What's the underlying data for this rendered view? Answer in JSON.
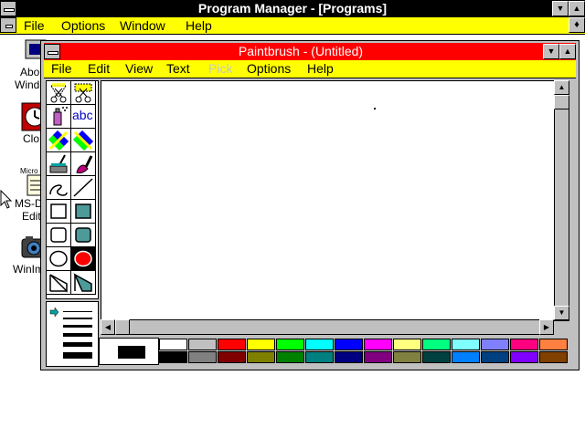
{
  "program_manager": {
    "title": "Program Manager - [Programs]",
    "menu": [
      "File",
      "Options",
      "Window",
      "Help"
    ]
  },
  "desktop_icons": [
    {
      "label_lines": [
        "Abo",
        "Windo"
      ],
      "icon": "about-windows-icon"
    },
    {
      "label_lines": [
        "Clo"
      ],
      "icon": "clock-icon"
    },
    {
      "label_lines": [
        "Micro",
        "MS-D",
        "Edit"
      ],
      "icon": "msdos-editor-icon"
    },
    {
      "label_lines": [
        "WinIm"
      ],
      "icon": "winimage-icon"
    }
  ],
  "paintbrush": {
    "title": "Paintbrush - (Untitled)",
    "menu": [
      {
        "label": "File",
        "enabled": true
      },
      {
        "label": "Edit",
        "enabled": true
      },
      {
        "label": "View",
        "enabled": true
      },
      {
        "label": "Text",
        "enabled": true
      },
      {
        "label": "Pick",
        "enabled": false
      },
      {
        "label": "Options",
        "enabled": true
      },
      {
        "label": "Help",
        "enabled": true
      }
    ],
    "tools": [
      "scissors-icon",
      "pick-scissors-icon",
      "airbrush-icon",
      "text-tool-icon",
      "color-eraser-icon",
      "eraser-icon",
      "paint-roller-icon",
      "brush-icon",
      "curve-icon",
      "line-icon",
      "box-icon",
      "filled-box-icon",
      "rounded-box-icon",
      "filled-rounded-box-icon",
      "circle-icon",
      "filled-circle-icon",
      "polygon-icon",
      "filled-polygon-icon"
    ],
    "text_tool_label": "abc",
    "selected_tool": "filled-circle-icon",
    "foreground_color": "#000000",
    "background_color": "#ffffff",
    "palette": [
      {
        "top": "#ffffff",
        "bottom": "#000000"
      },
      {
        "top": "#c0c0c0",
        "bottom": "#808080"
      },
      {
        "top": "#ff0000",
        "bottom": "#800000"
      },
      {
        "top": "#ffff00",
        "bottom": "#808000"
      },
      {
        "top": "#00ff00",
        "bottom": "#008000"
      },
      {
        "top": "#00ffff",
        "bottom": "#008080"
      },
      {
        "top": "#0000ff",
        "bottom": "#000080"
      },
      {
        "top": "#ff00ff",
        "bottom": "#800080"
      },
      {
        "top": "#ffff80",
        "bottom": "#808040"
      },
      {
        "top": "#00ff80",
        "bottom": "#004040"
      },
      {
        "top": "#80ffff",
        "bottom": "#0080ff"
      },
      {
        "top": "#8080ff",
        "bottom": "#004080"
      },
      {
        "top": "#ff0080",
        "bottom": "#8000ff"
      },
      {
        "top": "#ff8040",
        "bottom": "#804000"
      }
    ]
  }
}
